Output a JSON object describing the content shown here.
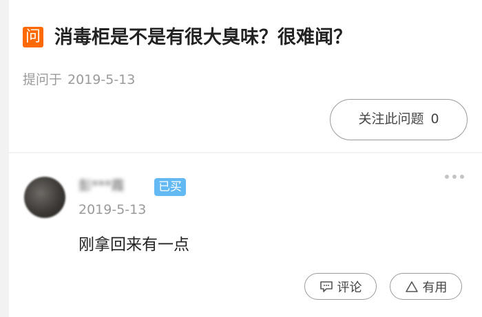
{
  "question": {
    "badge": "问",
    "title": "消毒柜是不是有很大臭味？很难闻？",
    "asked_prefix": "提问于",
    "asked_date": "2019-5-13",
    "follow_label": "关注此问题",
    "follow_count": "0"
  },
  "answer": {
    "username": "彭***霞",
    "bought_badge": "已买",
    "date": "2019-5-13",
    "content": "刚拿回来有一点",
    "comment_label": "评论",
    "useful_label": "有用"
  },
  "colors": {
    "accent": "#ff6a00",
    "bought_badge": "#62b9f3"
  },
  "icons": [
    "question-badge",
    "more-icon",
    "comment-icon",
    "thumbs-up-triangle-icon"
  ]
}
